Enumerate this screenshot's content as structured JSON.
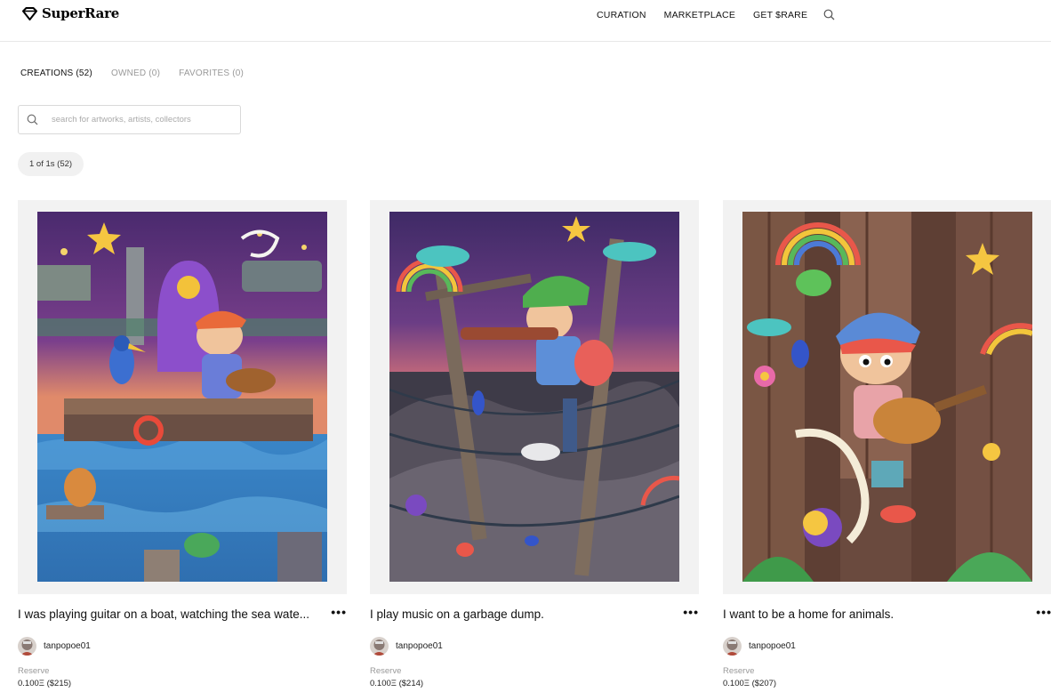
{
  "header": {
    "brand": "SuperRare",
    "nav": [
      "CURATION",
      "MARKETPLACE",
      "GET $RARE"
    ],
    "search_icon": "search-icon"
  },
  "tabs": [
    {
      "label": "CREATIONS (52)",
      "active": true
    },
    {
      "label": "OWNED (0)",
      "active": false
    },
    {
      "label": "FAVORITES (0)",
      "active": false
    }
  ],
  "search": {
    "placeholder": "search for artworks, artists, collectors",
    "value": ""
  },
  "filter": {
    "label": "1 of 1s (52)"
  },
  "cards": [
    {
      "title": "I was playing guitar on a boat, watching the sea wate...",
      "artist": "tanpopoe01",
      "reserve_label": "Reserve",
      "price": "0.100Ξ ($215)",
      "more_icon": "more-icon"
    },
    {
      "title": "I play music on a garbage dump.",
      "artist": "tanpopoe01",
      "reserve_label": "Reserve",
      "price": "0.100Ξ ($214)",
      "more_icon": "more-icon"
    },
    {
      "title": "I want to be a home for animals.",
      "artist": "tanpopoe01",
      "reserve_label": "Reserve",
      "price": "0.100Ξ ($207)",
      "more_icon": "more-icon"
    }
  ],
  "colors": {
    "text": "#111111",
    "muted": "#999999",
    "thumb_bg": "#f2f2f2",
    "pill_bg": "#f1f1f1"
  }
}
